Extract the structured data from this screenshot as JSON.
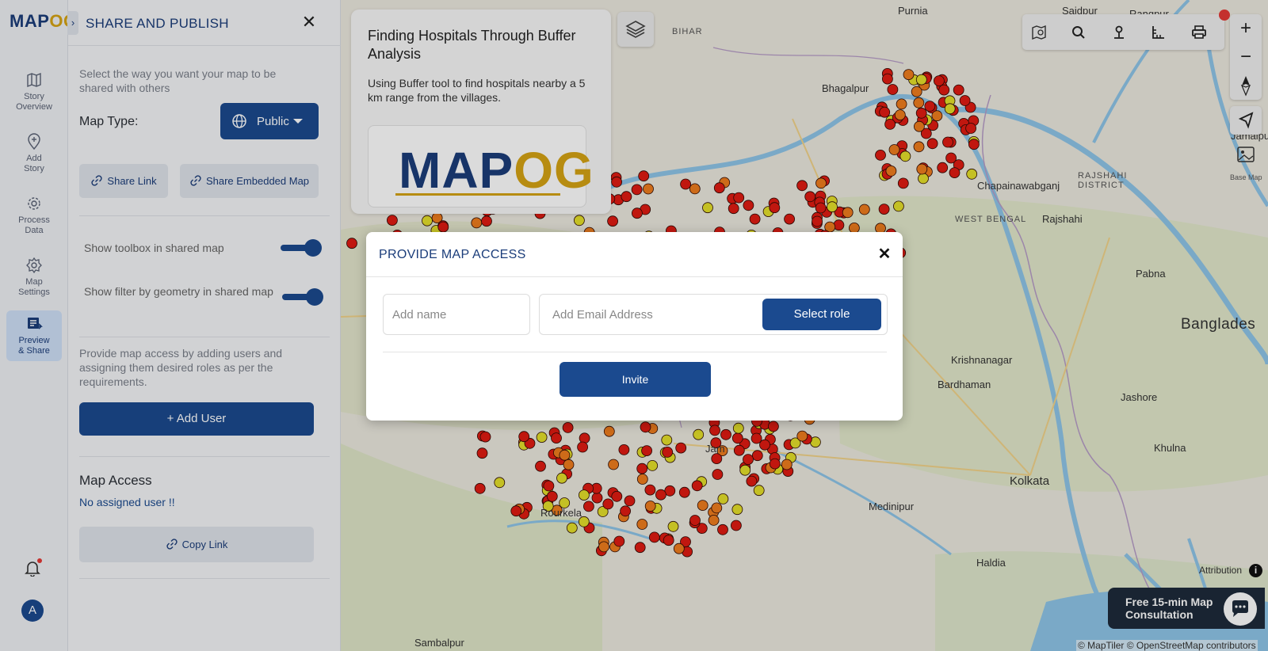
{
  "app": {
    "logo_main": "MAP",
    "logo_accent": "OG"
  },
  "rail": {
    "items": [
      {
        "label_1": "Story",
        "label_2": "Overview",
        "icon": "map-icon"
      },
      {
        "label_1": "Add",
        "label_2": "Story",
        "icon": "location-pin-icon"
      },
      {
        "label_1": "Process",
        "label_2": "Data",
        "icon": "cog-icon"
      },
      {
        "label_1": "Map",
        "label_2": "Settings",
        "icon": "gear-icon"
      },
      {
        "label_1": "Preview",
        "label_2": "& Share",
        "icon": "share-list-icon"
      }
    ],
    "active_index": 4,
    "avatar_initial": "A"
  },
  "panel": {
    "title": "SHARE AND PUBLISH",
    "intro": "Select the way you want your map to be shared with others",
    "map_type_label": "Map Type:",
    "map_type_value": "Public",
    "share_link_label": "Share Link",
    "share_embedded_label": "Share Embedded Map",
    "toggle_toolbox_label": "Show toolbox in shared map",
    "toggle_toolbox_on": true,
    "toggle_filter_label": "Show filter by geometry in shared map",
    "toggle_filter_on": true,
    "access_description": "Provide map access by adding users and assigning them desired roles as per the requirements.",
    "add_user_label": "+ Add User",
    "map_access_title": "Map Access",
    "no_user_text": "No assigned user !!",
    "copy_link_label": "Copy Link"
  },
  "story_card": {
    "title": "Finding Hospitals Through Buffer Analysis",
    "description": "Using Buffer tool to find hospitals nearby a 5 km range from the villages.",
    "image_logo_main": "MAP",
    "image_logo_accent": "OG"
  },
  "map": {
    "labels": {
      "purnia": "Purnia",
      "saidpur": "Saidpur",
      "rangpur": "Rangpur",
      "bihar": "BIHAR",
      "bhagalpur": "Bhagalpur",
      "jamalpur": "Jamalpur",
      "chapainawabganj": "Chapainawabganj",
      "rajshahi_div_1": "RAJSHAHI",
      "rajshahi_div_2": "DISTRICT",
      "west_bengal": "WEST BENGAL",
      "rajshahi": "Rajshahi",
      "pabna": "Pabna",
      "bangladesh": "Banglades",
      "krishnanagar": "Krishnanagar",
      "bardhaman": "Bardhaman",
      "jashore": "Jashore",
      "khulna": "Khulna",
      "kolkata": "Kolkata",
      "medinipur": "Medinipur",
      "rourkela": "Rourkela",
      "haldia": "Haldia",
      "sambalpur": "Sambalpur",
      "jam": "Jam"
    },
    "basemap_label": "Base Map",
    "attribution_label": "Attribution",
    "info_glyph": "i",
    "credits": "© MapTiler © OpenStreetMap contributors",
    "consult_text": "Free 15-min Map Consultation",
    "zoom_in": "+",
    "zoom_out": "−",
    "colors": {
      "water": "#8fc5e8",
      "land": "#ece9df",
      "marker_red": "#e01b12",
      "marker_orange": "#ef7d1e",
      "marker_yellow": "#e5e02a",
      "accent": "#1b4a8f"
    }
  },
  "modal": {
    "title": "PROVIDE MAP ACCESS",
    "name_placeholder": "Add name",
    "email_placeholder": "Add Email Address",
    "select_role_label": "Select role",
    "invite_label": "Invite"
  }
}
